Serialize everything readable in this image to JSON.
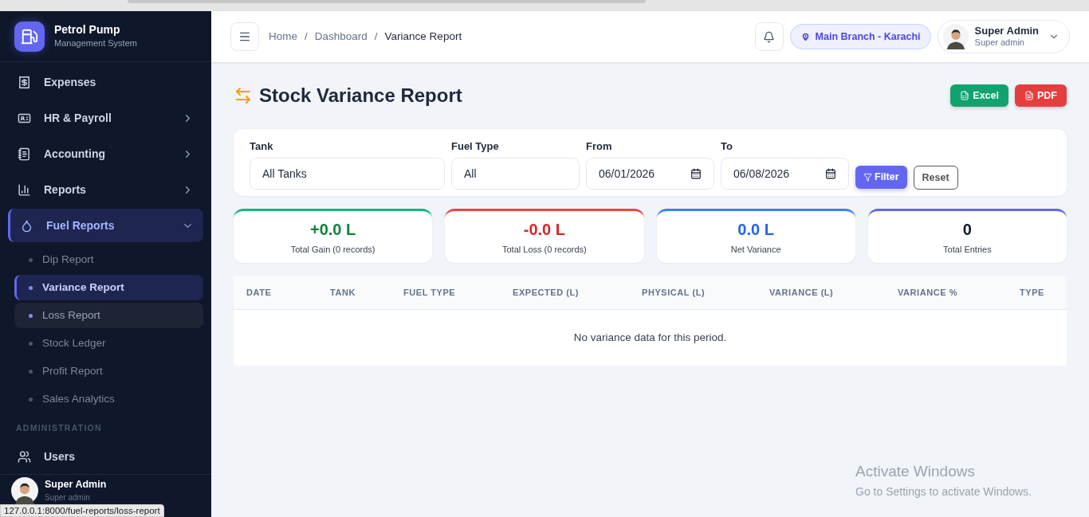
{
  "brand": {
    "title": "Petrol Pump",
    "subtitle": "Management System"
  },
  "sidebar": {
    "items": [
      {
        "kind": "nav",
        "label": "Expenses",
        "selected": false
      },
      {
        "kind": "nav",
        "label": "HR & Payroll",
        "selected": false,
        "expanded": false
      },
      {
        "kind": "nav",
        "label": "Accounting",
        "selected": false,
        "expanded": false
      },
      {
        "kind": "nav",
        "label": "Reports",
        "selected": false,
        "expanded": false
      },
      {
        "kind": "nav",
        "label": "Fuel Reports",
        "selected": true,
        "expanded": true,
        "children": [
          {
            "label": "Dip Report",
            "selected": false,
            "hovered": false
          },
          {
            "label": "Variance Report",
            "selected": true,
            "hovered": false
          },
          {
            "label": "Loss Report",
            "selected": false,
            "hovered": true
          },
          {
            "label": "Stock Ledger",
            "selected": false,
            "hovered": false
          },
          {
            "label": "Profit Report",
            "selected": false,
            "hovered": false
          },
          {
            "label": "Sales Analytics",
            "selected": false,
            "hovered": false
          }
        ]
      },
      {
        "kind": "section",
        "label": "ADMINISTRATION"
      },
      {
        "kind": "nav",
        "label": "Users",
        "selected": false
      }
    ],
    "user": {
      "name": "Super Admin",
      "role": "Super admin"
    }
  },
  "status_tooltip": "127.0.0.1:8000/fuel-reports/loss-report",
  "header": {
    "breadcrumb": [
      "Home",
      "Dashboard",
      "Variance Report"
    ],
    "separator": "/",
    "branch": "Main Branch - Karachi",
    "user": {
      "name": "Super Admin",
      "role": "Super admin"
    }
  },
  "page": {
    "title": "Stock Variance Report",
    "export_buttons": [
      {
        "kind": "excel",
        "label": "Excel"
      },
      {
        "kind": "pdf",
        "label": "PDF"
      }
    ]
  },
  "filters": {
    "fields": [
      {
        "kind": "select",
        "label": "Tank",
        "value": "All Tanks"
      },
      {
        "kind": "select",
        "label": "Fuel Type",
        "value": "All"
      },
      {
        "kind": "date",
        "label": "From",
        "value": "06/01/2026"
      },
      {
        "kind": "date",
        "label": "To",
        "value": "06/08/2026"
      }
    ],
    "filter_button": "Filter",
    "reset_button": "Reset"
  },
  "stats": [
    {
      "kind": "gain",
      "value": "+0.0 L",
      "label": "Total Gain (0 records)",
      "color": "#10b981"
    },
    {
      "kind": "loss",
      "value": "-0.0 L",
      "label": "Total Loss (0 records)",
      "color": "#ef4444"
    },
    {
      "kind": "net",
      "value": "0.0 L",
      "label": "Net Variance",
      "color": "#3b82f6"
    },
    {
      "kind": "count",
      "value": "0",
      "label": "Total Entries",
      "color": "#6366f1"
    }
  ],
  "table": {
    "columns": [
      "DATE",
      "TANK",
      "FUEL TYPE",
      "EXPECTED (L)",
      "PHYSICAL (L)",
      "VARIANCE (L)",
      "VARIANCE %",
      "TYPE"
    ],
    "empty_message": "No variance data for this period."
  },
  "os_notice": {
    "title": "Activate Windows",
    "text": "Go to Settings to activate Windows."
  }
}
